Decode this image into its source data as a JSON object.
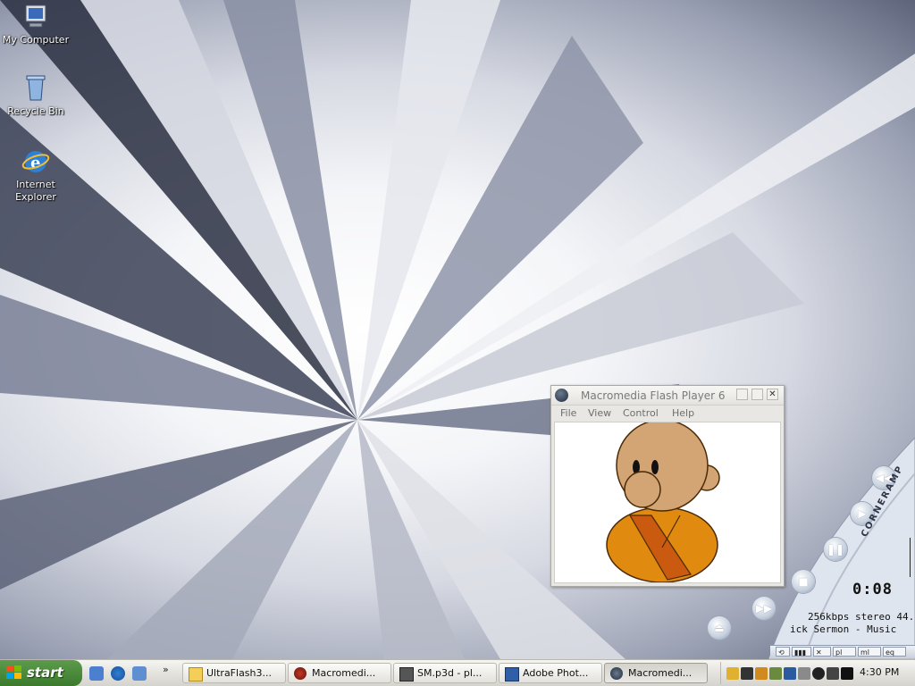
{
  "desktop": {
    "icons": [
      {
        "label": "My Computer",
        "icon": "my-computer-icon"
      },
      {
        "label": "Recycle Bin",
        "icon": "recycle-bin-icon"
      },
      {
        "label": "Internet\nExplorer",
        "icon": "internet-explorer-icon"
      }
    ]
  },
  "flash_window": {
    "title": "Macromedia Flash Player 6",
    "menu": [
      "File",
      "View",
      "Control",
      "Help"
    ],
    "close_glyph": "✕",
    "monk_colors": {
      "skin": "#d4a574",
      "robe": "#e08a10",
      "sash": "#c95a10"
    }
  },
  "corneramp": {
    "brand": "CORNERAMP",
    "time": "0:08",
    "info": "256kbps stereo 44.",
    "track": "ick Sermon - Music",
    "buttons": [
      "rewind",
      "play",
      "pause",
      "stop",
      "fast-forward",
      "eject"
    ],
    "mini_buttons": [
      "pl",
      "ml",
      "eq"
    ]
  },
  "taskbar": {
    "start_label": "start",
    "quick_launch_chevron": "»",
    "tasks": [
      {
        "label": "UltraFlash3...",
        "icon": "folder-icon",
        "active": false
      },
      {
        "label": "Macromedi...",
        "icon": "flash-icon",
        "active": false
      },
      {
        "label": "SM.p3d - pl...",
        "icon": "document-icon",
        "active": false
      },
      {
        "label": "Adobe Phot...",
        "icon": "photoshop-icon",
        "active": false
      },
      {
        "label": "Macromedi...",
        "icon": "flash-icon",
        "active": true
      }
    ],
    "clock": "4:30 PM"
  }
}
